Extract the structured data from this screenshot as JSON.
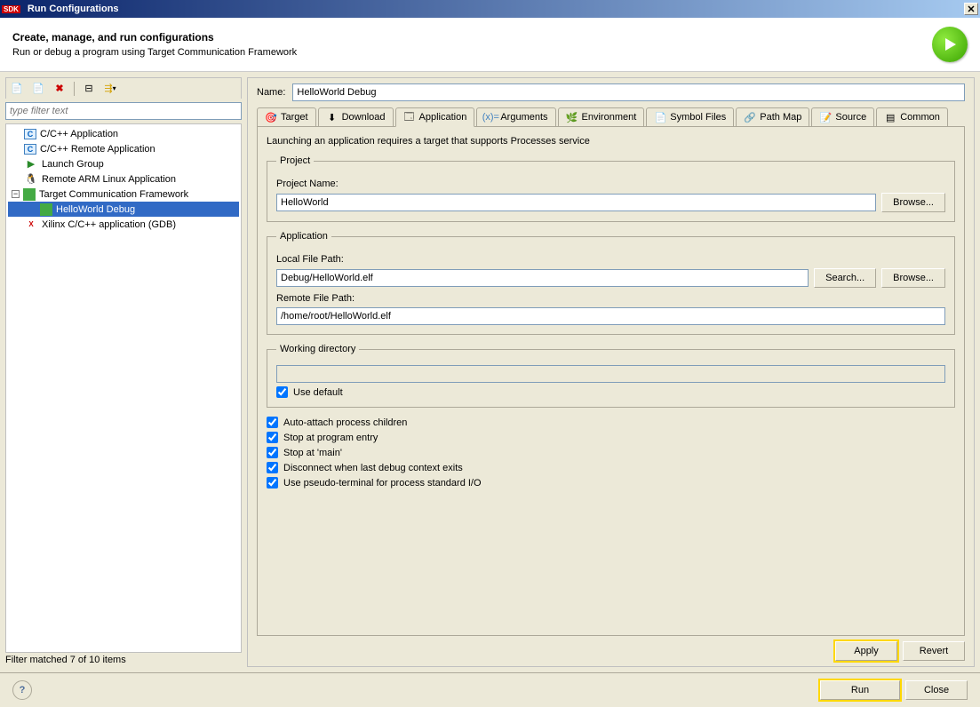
{
  "titlebar": {
    "sdk": "SDK",
    "title": "Run Configurations"
  },
  "header": {
    "title": "Create, manage, and run configurations",
    "subtitle": "Run or debug a program using Target Communication Framework"
  },
  "filter": {
    "placeholder": "type filter text"
  },
  "tree": [
    {
      "label": "C/C++ Application"
    },
    {
      "label": "C/C++ Remote Application"
    },
    {
      "label": "Launch Group"
    },
    {
      "label": "Remote ARM Linux Application"
    },
    {
      "label": "Target Communication Framework"
    },
    {
      "label": "HelloWorld Debug"
    },
    {
      "label": "Xilinx C/C++ application (GDB)"
    }
  ],
  "status": "Filter matched 7 of 10 items",
  "name_label": "Name:",
  "name_value": "HelloWorld Debug",
  "tabs": [
    {
      "label": "Target"
    },
    {
      "label": "Download"
    },
    {
      "label": "Application"
    },
    {
      "label": "Arguments"
    },
    {
      "label": "Environment"
    },
    {
      "label": "Symbol Files"
    },
    {
      "label": "Path Map"
    },
    {
      "label": "Source"
    },
    {
      "label": "Common"
    }
  ],
  "app": {
    "desc": "Launching an application requires a target that supports Processes service",
    "project_legend": "Project",
    "project_name_label": "Project Name:",
    "project_name": "HelloWorld",
    "browse": "Browse...",
    "application_legend": "Application",
    "local_path_label": "Local File Path:",
    "local_path": "Debug/HelloWorld.elf",
    "search": "Search...",
    "remote_path_label": "Remote File Path:",
    "remote_path": "/home/root/HelloWorld.elf",
    "workdir_legend": "Working directory",
    "use_default": "Use default",
    "opts": [
      "Auto-attach process children",
      "Stop at program entry",
      "Stop at 'main'",
      "Disconnect when last debug context exits",
      "Use pseudo-terminal for process standard I/O"
    ]
  },
  "buttons": {
    "apply": "Apply",
    "revert": "Revert",
    "run": "Run",
    "close": "Close"
  },
  "icons": {
    "new": "📄",
    "dup": "📄",
    "del": "✖",
    "col": "⊟",
    "exp": "▾",
    "c": "C",
    "launch": "▶",
    "penguin": "🐧",
    "tcf": "",
    "gdb": "X"
  }
}
